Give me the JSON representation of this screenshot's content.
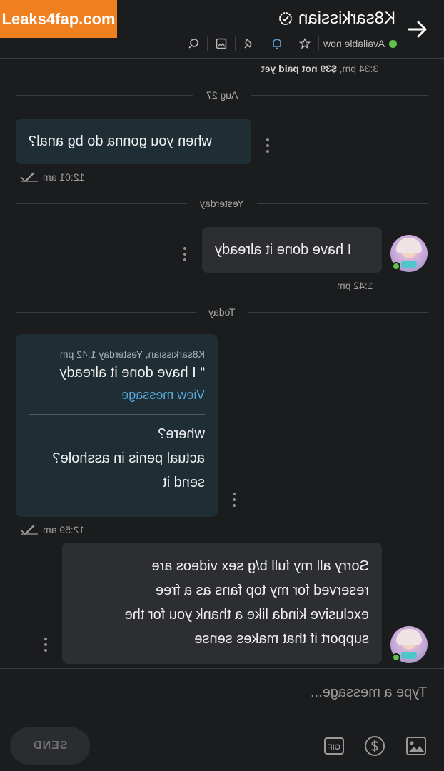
{
  "watermark": {
    "text": "Leaks4fap.com"
  },
  "header": {
    "name": "K8sarkissian",
    "status": "Available now",
    "icons": [
      "arrow-right-icon",
      "verified-icon",
      "star-icon",
      "bell-icon",
      "pin-icon",
      "image-icon",
      "search-icon"
    ]
  },
  "paid_note": {
    "prefix": "3:34 pm,",
    "amount": "$39 not paid yet"
  },
  "dividers": {
    "aug": "Aug 27",
    "yesterday": "Yesterday",
    "today": "Today"
  },
  "messages": {
    "m1": {
      "text": "when you gonna do bg anal?",
      "time": "12:01 am"
    },
    "m2": {
      "text": "I have done it already",
      "time": "1:42 pm"
    },
    "m3": {
      "quote_meta": "K8sarkissian, Yesterday 1:42 pm",
      "quote_text": "“ I have done it already",
      "quote_link": "View message",
      "lines": [
        "where?",
        "actual penis in asshole?",
        "send it"
      ],
      "time": "12:59 am"
    },
    "m4": {
      "lines": [
        "Sorry all my full b/g sex videos are",
        "reserved for my top fans as a free",
        "exclusive kinda like a thank you for the",
        "support if that makes sense"
      ]
    }
  },
  "composer": {
    "placeholder": "Type a message...",
    "send_label": "SEND",
    "gif_label": "GIF",
    "icons": [
      "image-icon",
      "tip-icon",
      "gif-icon"
    ]
  },
  "colors": {
    "accent_online": "#5fc14b",
    "link": "#56a6d8",
    "bell": "#5aa9e0",
    "watermark": "#f07f1f"
  }
}
